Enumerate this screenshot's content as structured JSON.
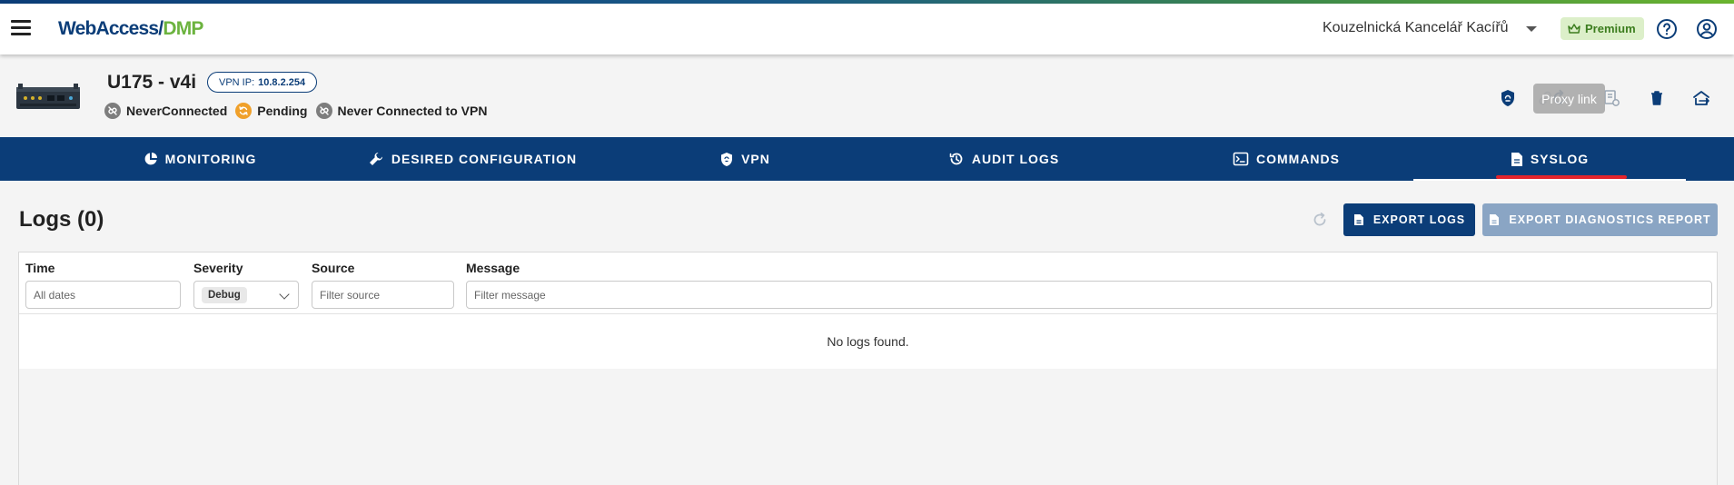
{
  "app": {
    "logo_part1": "WebAccess/",
    "logo_part2": "DMP",
    "organization": "Kouzelnická Kancelář Kacířů",
    "premium_label": "Premium"
  },
  "device": {
    "name": "U175 - v4i",
    "vpn_ip_label": "VPN IP:",
    "vpn_ip": "10.8.2.254",
    "statuses": [
      {
        "label": "NeverConnected",
        "icon": "disconnected-icon"
      },
      {
        "label": "Pending",
        "icon": "sync-icon"
      },
      {
        "label": "Never Connected to VPN",
        "icon": "disconnected-icon"
      }
    ]
  },
  "actions": {
    "tooltip": "Proxy link",
    "icons": [
      "shield-icon",
      "link-icon",
      "reload-icon",
      "config-icon",
      "delete-icon",
      "transfer-icon"
    ]
  },
  "tabs": [
    {
      "label": "MONITORING",
      "icon": "pie-chart-icon"
    },
    {
      "label": "DESIRED CONFIGURATION",
      "icon": "wrench-icon"
    },
    {
      "label": "VPN",
      "icon": "shield-icon"
    },
    {
      "label": "AUDIT LOGS",
      "icon": "history-icon"
    },
    {
      "label": "COMMANDS",
      "icon": "terminal-icon"
    },
    {
      "label": "SYSLOG",
      "icon": "document-icon",
      "active": true
    }
  ],
  "logs": {
    "title": "Logs (0)",
    "export_label": "EXPORT LOGS",
    "diag_label": "EXPORT DIAGNOSTICS REPORT",
    "columns": {
      "time": "Time",
      "severity": "Severity",
      "source": "Source",
      "message": "Message"
    },
    "filters": {
      "time_placeholder": "All dates",
      "severity_value": "Debug",
      "source_placeholder": "Filter source",
      "message_placeholder": "Filter message"
    },
    "empty_text": "No logs found."
  },
  "colors": {
    "brand_navy": "#0b3d78",
    "brand_green": "#6cb33f",
    "active_tab_indicator": "#e4242b",
    "pending_orange": "#f0a02a"
  }
}
